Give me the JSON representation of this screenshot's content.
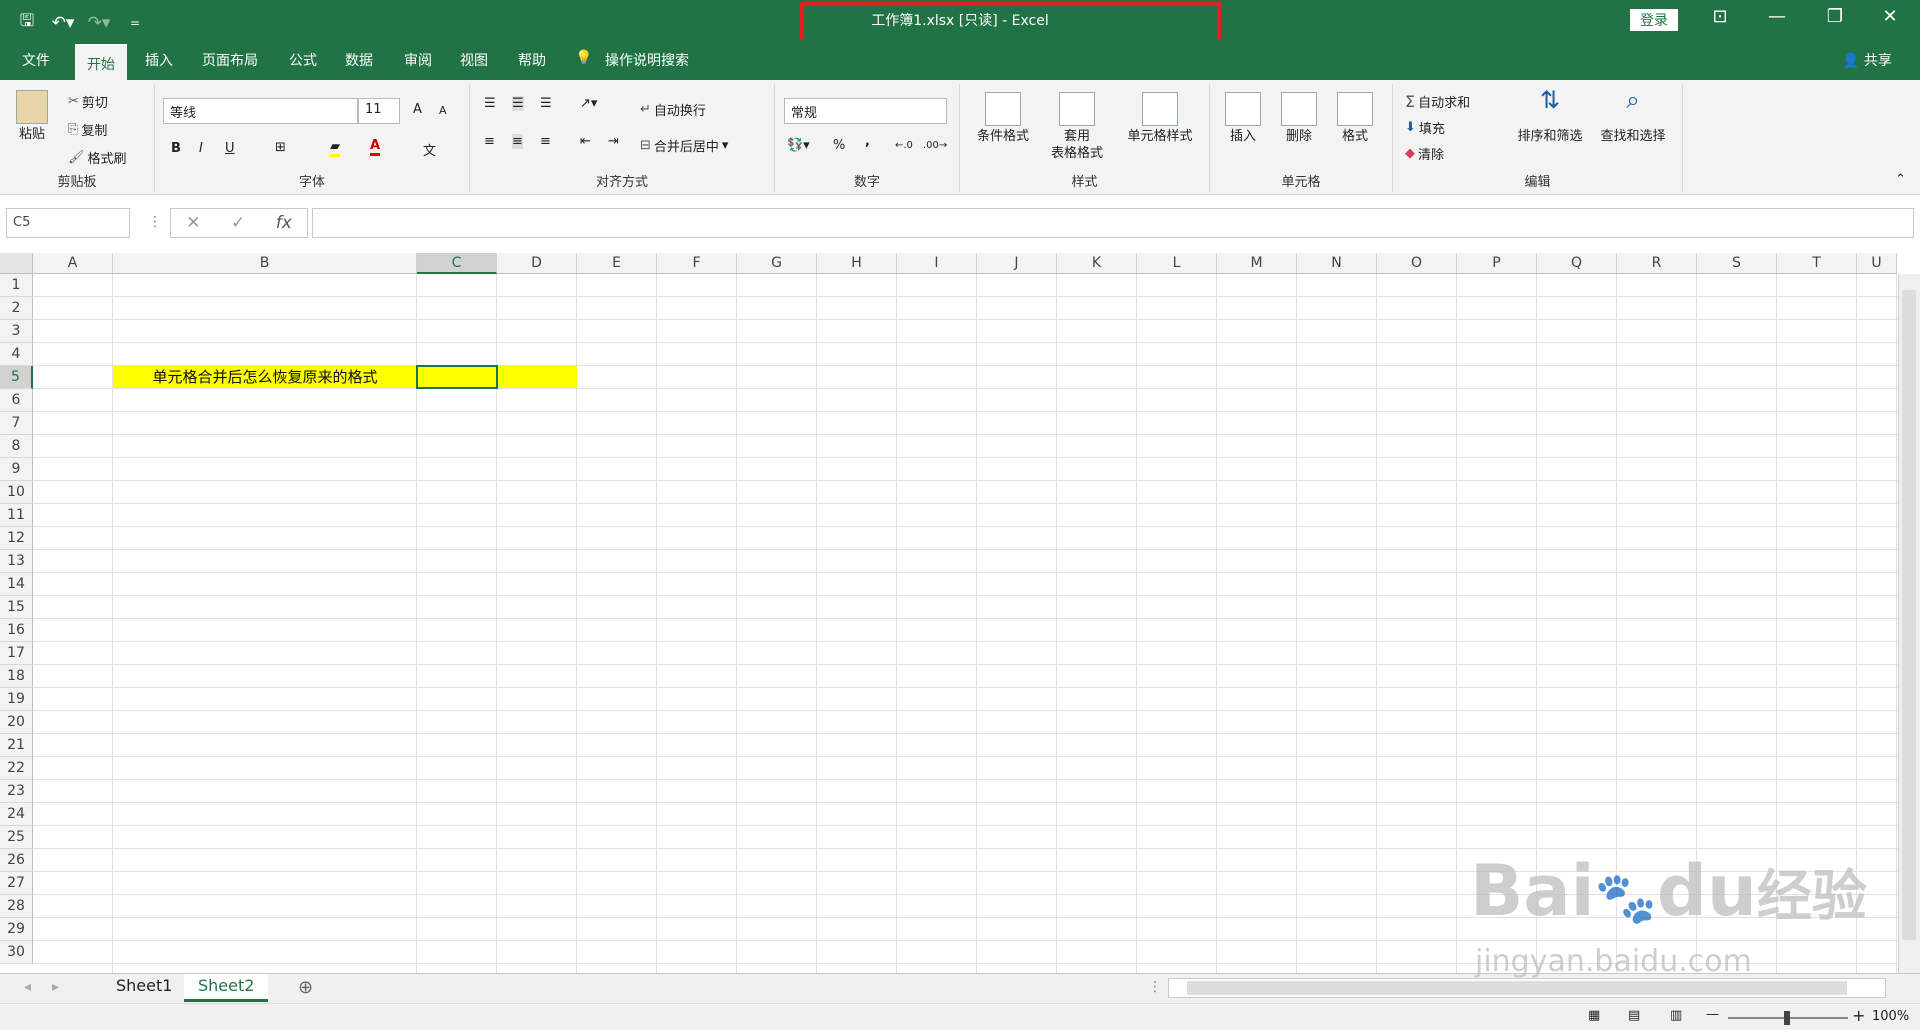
{
  "window": {
    "title": "工作簿1.xlsx  [只读]  -  Excel",
    "login": "登录",
    "share": "共享",
    "qat_more": "="
  },
  "tabs": [
    "文件",
    "开始",
    "插入",
    "页面布局",
    "公式",
    "数据",
    "审阅",
    "视图",
    "帮助"
  ],
  "tell_me": "操作说明搜索",
  "ribbon": {
    "clipboard": {
      "label": "剪贴板",
      "paste": "粘贴",
      "cut": "剪切",
      "copy": "复制",
      "painter": "格式刷"
    },
    "font": {
      "label": "字体",
      "name": "等线",
      "size": "11",
      "bold": "B",
      "italic": "I",
      "underline": "U",
      "grow": "A",
      "shrink": "A",
      "color_letter": "A",
      "wen": "文"
    },
    "align": {
      "label": "对齐方式",
      "wrap": "自动换行",
      "merge": "合并后居中"
    },
    "number": {
      "label": "数字",
      "format": "常规",
      "percent": "%",
      "comma": ","
    },
    "styles": {
      "label": "样式",
      "cond": "条件格式",
      "table1": "套用",
      "table2": "表格格式",
      "cell": "单元格样式"
    },
    "cells": {
      "label": "单元格",
      "insert": "插入",
      "delete": "删除",
      "format": "格式"
    },
    "edit": {
      "label": "编辑",
      "autosum": "自动求和",
      "fill": "填充",
      "clear": "清除",
      "sort": "排序和筛选",
      "find": "查找和选择"
    }
  },
  "namebox": "C5",
  "fx": "fx",
  "columns": [
    "A",
    "B",
    "C",
    "D",
    "E",
    "F",
    "G",
    "H",
    "I",
    "J",
    "K",
    "L",
    "M",
    "N",
    "O",
    "P",
    "Q",
    "R",
    "S",
    "T",
    "U"
  ],
  "rows": [
    "1",
    "2",
    "3",
    "4",
    "5",
    "6",
    "7",
    "8",
    "9",
    "10",
    "11",
    "12",
    "13",
    "14",
    "15",
    "16",
    "17",
    "18",
    "19",
    "20",
    "21",
    "22",
    "23",
    "24",
    "25",
    "26",
    "27",
    "28",
    "29",
    "30"
  ],
  "cell_b5": "单元格合并后怎么恢复原来的格式",
  "sheets": [
    "Sheet1",
    "Sheet2"
  ],
  "active_sheet": "Sheet2",
  "zoom": "100%",
  "watermark": {
    "brand": "Bai",
    "brand2": "du",
    "cn": "经验",
    "url": "jingyan.baidu.com"
  },
  "colors": {
    "excel_green": "#217346",
    "highlight": "#ffff00",
    "red_box": "#e02020"
  }
}
